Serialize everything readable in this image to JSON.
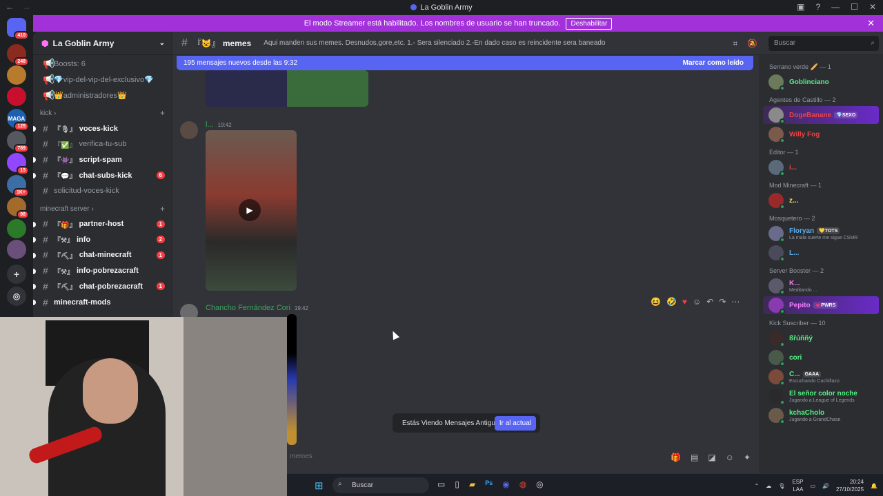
{
  "window": {
    "title": "La Goblin Army"
  },
  "banner": {
    "text": "El modo Streamer está habilitado. Los nombres de usuario se han truncado.",
    "button": "Deshabilitar"
  },
  "guilds": [
    {
      "label": "",
      "badge": "410",
      "color": "#5865f2"
    },
    {
      "label": "",
      "badge": "248",
      "color": "#8b2a1e"
    },
    {
      "label": "",
      "badge": "",
      "color": "#b87a2c"
    },
    {
      "label": "",
      "badge": "",
      "color": "#c8102e"
    },
    {
      "label": "MAGA",
      "badge": "125",
      "color": "#1d5fb0"
    },
    {
      "label": "",
      "badge": "789",
      "color": "#55585f"
    },
    {
      "label": "",
      "badge": "15",
      "color": "#9146ff"
    },
    {
      "label": "",
      "badge": "1K+",
      "color": "#3b6ea5"
    },
    {
      "label": "",
      "badge": "98",
      "color": "#a36b2a"
    },
    {
      "label": "",
      "badge": "",
      "color": "#2a7a2a"
    },
    {
      "label": "",
      "badge": "",
      "color": "#6a4f7a"
    }
  ],
  "server": {
    "name": "La Goblin Army",
    "top_items": [
      "Boosts: 6",
      "💎vip-del-vip-del-exclusivo💎",
      "👑administradores👑"
    ],
    "categories": [
      {
        "name": "kick",
        "channels": [
          {
            "name": "voces-kick",
            "tag": "『🎙』",
            "unread": true,
            "count": ""
          },
          {
            "name": "verifica-tu-sub",
            "tag": "『✅』",
            "unread": false,
            "count": ""
          },
          {
            "name": "script-spam",
            "tag": "『👾』",
            "unread": true,
            "count": ""
          },
          {
            "name": "chat-subs-kick",
            "tag": "『💬』",
            "unread": true,
            "count": "6"
          },
          {
            "name": "solicitud-voces-kick",
            "tag": "",
            "unread": false,
            "count": ""
          }
        ]
      },
      {
        "name": "minecraft server",
        "channels": [
          {
            "name": "partner-host",
            "tag": "『🎁』",
            "unread": true,
            "count": "1"
          },
          {
            "name": "info",
            "tag": "『⚒』",
            "unread": true,
            "count": "2"
          },
          {
            "name": "chat-minecraft",
            "tag": "『⛏』",
            "unread": true,
            "count": "1"
          },
          {
            "name": "info-pobrezacraft",
            "tag": "『⚒』",
            "unread": true,
            "count": ""
          },
          {
            "name": "chat-pobrezacraft",
            "tag": "『⛏』",
            "unread": true,
            "count": "1"
          },
          {
            "name": "minecraft-mods",
            "tag": "",
            "unread": true,
            "count": ""
          }
        ]
      }
    ]
  },
  "channel": {
    "name": "memes",
    "tag": "『😺』",
    "topic": "Aqui manden sus memes. Desnudos,gore,etc. 1.- Sera silenciado 2.-En dado caso es reincidente sera baneado",
    "search_placeholder": "Buscar",
    "new_messages": "195 mensajes nuevos desde las 9:32",
    "mark_read": "Marcar como leído",
    "input_placeholder": "memes"
  },
  "messages": [
    {
      "author": "l...",
      "time": "19:42"
    },
    {
      "author": "Chancho Fernández Cori",
      "time": "19:42"
    }
  ],
  "old_messages": {
    "text": "Estás Viendo Mensajes Antiguos",
    "button": "Ir al actual"
  },
  "members": {
    "groups": [
      {
        "name": "Serrano verde 🥖 — 1",
        "members": [
          {
            "name": "Goblinciano",
            "color": "#57f287",
            "badge": "",
            "sub": ""
          }
        ]
      },
      {
        "name": "Agentes de Castillo — 2",
        "members": [
          {
            "name": "DogeBanane",
            "color": "#ed4245",
            "badge": "💎SEXO",
            "sub": ""
          },
          {
            "name": "Willy Fog",
            "color": "#ed4245",
            "badge": "",
            "sub": ""
          }
        ]
      },
      {
        "name": "Editor — 1",
        "members": [
          {
            "name": "i...",
            "color": "#ed4245",
            "badge": "",
            "sub": ""
          }
        ]
      },
      {
        "name": "Mod Minecraft — 1",
        "members": [
          {
            "name": "z...",
            "color": "#fee75c",
            "badge": "",
            "sub": ""
          }
        ]
      },
      {
        "name": "Mosquetero — 2",
        "members": [
          {
            "name": "Floryan",
            "color": "#5dadec",
            "badge": "💛TOTS",
            "sub": "La mala suerte me sigue CSMR"
          },
          {
            "name": "L...",
            "color": "#5dadec",
            "badge": "",
            "sub": ""
          }
        ]
      },
      {
        "name": "Server Booster — 2",
        "members": [
          {
            "name": "K...",
            "color": "#f47fff",
            "badge": "",
            "sub": "Meditando ..."
          },
          {
            "name": "Pepito",
            "color": "#f47fff",
            "badge": "💗PWRS",
            "sub": ""
          }
        ]
      },
      {
        "name": "Kick Suscriber — 10",
        "members": [
          {
            "name": "ßřúññý",
            "color": "#57f287",
            "badge": "",
            "sub": ""
          },
          {
            "name": "cori",
            "color": "#57f287",
            "badge": "",
            "sub": ""
          },
          {
            "name": "C...",
            "color": "#57f287",
            "badge": "GAAA",
            "sub": "Escuchando Cuchillazo"
          },
          {
            "name": "El señor color noche",
            "color": "#57f287",
            "badge": "",
            "sub": "Jugando a League of Legends"
          },
          {
            "name": "kchaCholo",
            "color": "#57f287",
            "badge": "",
            "sub": "Jugando a GrandChase"
          }
        ]
      }
    ]
  },
  "taskbar": {
    "search": "Buscar",
    "lang": "ESP",
    "lang2": "LAA",
    "time": "20:24",
    "date": "27/10/2025"
  },
  "colors": {
    "accent": "#5865f2",
    "banner": "#a231d9",
    "online": "#23a55a"
  }
}
